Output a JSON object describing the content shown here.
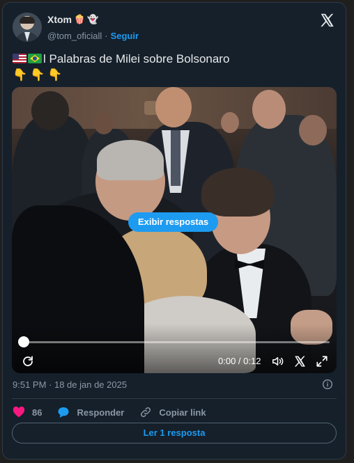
{
  "author": {
    "display_name": "Xtom",
    "name_emojis": [
      "popcorn-emoji",
      "ghost-emoji"
    ],
    "handle": "@tom_oficiall",
    "separator": "·",
    "follow_label": "Seguir"
  },
  "tweet": {
    "flags": [
      "flag-us",
      "flag-br"
    ],
    "text": "l Palabras de Milei sobre Bolsonaro",
    "pointing": "👇👇👇"
  },
  "video": {
    "overlay_label": "Exibir respostas",
    "time": "0:00 / 0:12",
    "progress": 0.0
  },
  "meta": {
    "timestamp": "9:51 PM · 18 de jan de 2025"
  },
  "actions": {
    "likes": "86",
    "reply_label": "Responder",
    "copy_label": "Copiar link"
  },
  "read_button": "Ler 1 resposta",
  "colors": {
    "accent": "#1d9bf0",
    "like": "#f91880",
    "background": "#15202b"
  }
}
